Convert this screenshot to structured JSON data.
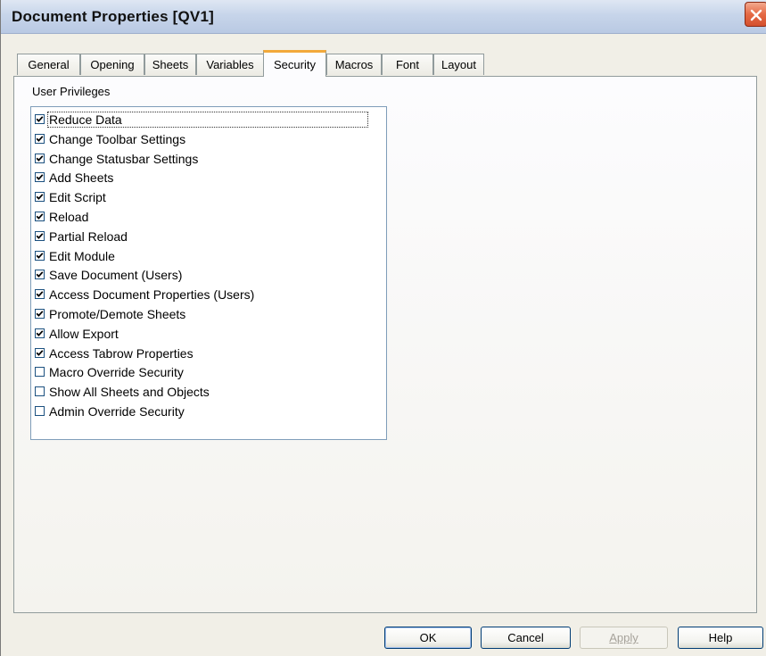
{
  "window": {
    "title": "Document Properties [QV1]"
  },
  "tabs": [
    {
      "label": "General"
    },
    {
      "label": "Opening"
    },
    {
      "label": "Sheets"
    },
    {
      "label": "Variables"
    },
    {
      "label": "Security"
    },
    {
      "label": "Macros"
    },
    {
      "label": "Font"
    },
    {
      "label": "Layout"
    }
  ],
  "active_tab": "Security",
  "security": {
    "group_label": "User Privileges",
    "items": [
      {
        "label": "Reduce Data",
        "checked": true
      },
      {
        "label": "Change Toolbar Settings",
        "checked": true
      },
      {
        "label": "Change Statusbar Settings",
        "checked": true
      },
      {
        "label": "Add Sheets",
        "checked": true
      },
      {
        "label": "Edit Script",
        "checked": true
      },
      {
        "label": "Reload",
        "checked": true
      },
      {
        "label": "Partial Reload",
        "checked": true
      },
      {
        "label": "Edit Module",
        "checked": true
      },
      {
        "label": "Save Document (Users)",
        "checked": true
      },
      {
        "label": "Access Document Properties (Users)",
        "checked": true
      },
      {
        "label": "Promote/Demote Sheets",
        "checked": true
      },
      {
        "label": "Allow Export",
        "checked": true
      },
      {
        "label": "Access Tabrow Properties",
        "checked": true
      },
      {
        "label": "Macro Override Security",
        "checked": false
      },
      {
        "label": "Show All Sheets and Objects",
        "checked": false
      },
      {
        "label": "Admin Override Security",
        "checked": false
      }
    ]
  },
  "buttons": {
    "ok": "OK",
    "cancel": "Cancel",
    "apply": "Apply",
    "help": "Help"
  },
  "colors": {
    "active_tab_accent": "#f2a93b",
    "close_button": "#e56a45",
    "listbox_border": "#7f9db9"
  }
}
